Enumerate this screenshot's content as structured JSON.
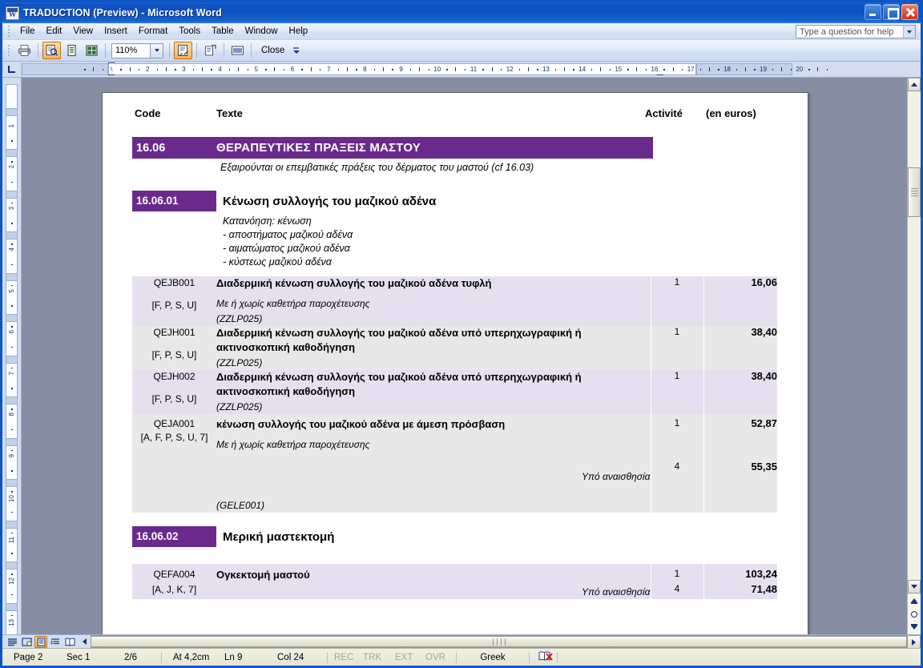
{
  "window": {
    "title": "TRADUCTION (Preview) - Microsoft Word",
    "app_icon": "word-document-icon",
    "minimize_label": "Minimize",
    "maximize_label": "Maximize",
    "close_label": "Close"
  },
  "menubar": {
    "items": [
      {
        "label": "File",
        "mnemonic": "F"
      },
      {
        "label": "Edit",
        "mnemonic": "E"
      },
      {
        "label": "View",
        "mnemonic": "V"
      },
      {
        "label": "Insert",
        "mnemonic": "I"
      },
      {
        "label": "Format",
        "mnemonic": "o"
      },
      {
        "label": "Tools",
        "mnemonic": "T"
      },
      {
        "label": "Table",
        "mnemonic": "a"
      },
      {
        "label": "Window",
        "mnemonic": "W"
      },
      {
        "label": "Help",
        "mnemonic": "H"
      }
    ],
    "help_box_placeholder": "Type a question for help"
  },
  "toolbar": {
    "buttons": [
      {
        "name": "print-icon",
        "label": "Print"
      },
      {
        "name": "magnifier-icon",
        "label": "Magnifier",
        "active": true
      },
      {
        "name": "one-page-icon",
        "label": "One Page"
      },
      {
        "name": "multiple-pages-icon",
        "label": "Multiple Pages"
      }
    ],
    "zoom_value": "110%",
    "shrink_to_fit_label": "Shrink to Fit",
    "full_screen_label": "Full Screen",
    "close_label": "Close",
    "overflow_label": "Toolbar Options"
  },
  "ruler": {
    "horizontal_ticks": [
      "1",
      "2",
      "3",
      "4",
      "5",
      "6",
      "7",
      "8",
      "9",
      "10",
      "11",
      "12",
      "13",
      "14",
      "15",
      "16",
      "17",
      "18",
      "19",
      "20"
    ],
    "vertical_ticks": [
      "1",
      "2",
      "3",
      "4",
      "5",
      "6",
      "7",
      "8",
      "9",
      "10",
      "11",
      "12",
      "13"
    ],
    "tab_selector": "left-tab-stop"
  },
  "document": {
    "columns": {
      "code": "Code",
      "texte": "Texte",
      "activite": "Activité",
      "euros": "(en euros)"
    },
    "sections": [
      {
        "number": "16.06",
        "title": "ΘΕΡΑΠΕΥΤΙΚΕΣ  ΠΡΑΞΕΙΣ  ΜΑΣΤΟΥ",
        "note": "Εξαιρούνται οι επεμβατικές πράξεις του δέρματος του μαστού (cf 16.03)"
      }
    ],
    "subsections": [
      {
        "number": "16.06.01",
        "title": "Κένωση συλλογής του μαζικού αδένα",
        "notes": [
          "Κατανόηση: κένωση",
          "- αποστήματος μαζικού αδένα",
          "- αιματώματος  μαζικού αδένα",
          "-  κύστεως μαζικού αδένα"
        ]
      },
      {
        "number": "16.06.02",
        "title": "Μερική μαστεκτομή",
        "notes": []
      }
    ],
    "rows_group1": [
      {
        "code": "QEJB001",
        "mods": "[F, P, S, U]",
        "main": "Διαδερμική κένωση συλλογής του μαζικού αδένα τυφλή",
        "italic": "Με ή χωρίς καθετήρα παροχέτευσης",
        "code2": "(ZZLP025)",
        "activite": "1",
        "euros": "16,06",
        "shade": "lavender"
      },
      {
        "code": "QEJH001",
        "mods": "[F, P, S, U]",
        "main": "Διαδερμική κένωση συλλογής του μαζικού αδένα υπό υπερηχωγραφική ή ακτινοσκοπική καθοδήγηση",
        "italic": "",
        "code2": "(ZZLP025)",
        "activite": "1",
        "euros": "38,40",
        "shade": "gray"
      },
      {
        "code": "QEJH002",
        "mods": "[F, P, S, U]",
        "main": "Διαδερμική κένωση συλλογής του μαζικού αδένα υπό υπερηχωγραφική ή ακτινοσκοπική καθοδήγηση",
        "italic": "",
        "code2": "(ZZLP025)",
        "activite": "1",
        "euros": "38,40",
        "shade": "lavender"
      },
      {
        "code": "QEJA001",
        "mods": "[A, F, P, S, U, 7]",
        "main": "κένωση συλλογής του μαζικού αδένα  με άμεση πρόσβαση",
        "italic": "Με ή χωρίς καθετήρα παροχέτευσης",
        "code2": "(GELE001)",
        "activite": "1",
        "euros": "52,87",
        "anesthesia_label": "Υπό αναισθησία",
        "anesthesia_activite": "4",
        "anesthesia_euros": "55,35",
        "shade": "gray"
      }
    ],
    "rows_group2": [
      {
        "code": "QEFA004",
        "mods": "[A, J, K, 7]",
        "main": "Ογκεκτομή μαστού",
        "activite": "1",
        "euros": "103,24",
        "anesthesia_label": "Υπό αναισθησία",
        "anesthesia_activite": "4",
        "anesthesia_euros": "71,48",
        "shade": "lavender"
      }
    ]
  },
  "statusbar": {
    "page": "Page  2",
    "section": "Sec  1",
    "page_of": "2/6",
    "at": "At  4,2cm",
    "line": "Ln  9",
    "column": "Col  24",
    "rec": "REC",
    "trk": "TRK",
    "ext": "EXT",
    "ovr": "OVR",
    "language": "Greek",
    "spellcheck_icon": "spelling-grammar-check-icon"
  },
  "view_buttons": [
    {
      "name": "normal-view-icon"
    },
    {
      "name": "web-layout-view-icon"
    },
    {
      "name": "print-layout-view-icon",
      "active": true
    },
    {
      "name": "outline-view-icon"
    },
    {
      "name": "reading-layout-view-icon"
    }
  ],
  "colors": {
    "banner_purple": "#6a2a8c",
    "row_lavender": "#e5dff0",
    "row_gray": "#e8e8e8",
    "titlebar_blue": "#0d4fc0",
    "canvas_gray": "#868ea4"
  }
}
